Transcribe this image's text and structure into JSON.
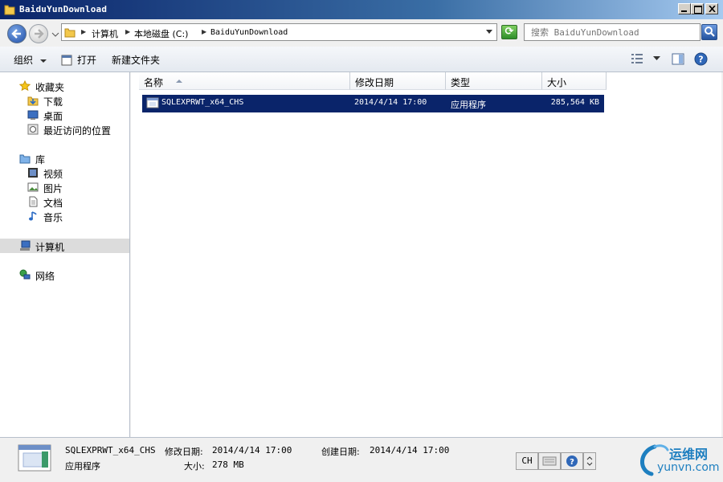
{
  "window": {
    "title": "BaiduYunDownload"
  },
  "address": {
    "crumbs": [
      "计算机",
      "本地磁盘 (C:)",
      "BaiduYunDownload"
    ]
  },
  "search": {
    "placeholder": "搜索 BaiduYunDownload"
  },
  "toolbar": {
    "organize": "组织",
    "open": "打开",
    "new_folder": "新建文件夹"
  },
  "sidebar": {
    "favorites": "收藏夹",
    "favorites_items": [
      "下载",
      "桌面",
      "最近访问的位置"
    ],
    "libraries": "库",
    "library_items": [
      "视频",
      "图片",
      "文档",
      "音乐"
    ],
    "computer": "计算机",
    "network": "网络"
  },
  "columns": [
    "名称",
    "修改日期",
    "类型",
    "大小"
  ],
  "files": [
    {
      "name": "SQLEXPRWT_x64_CHS",
      "modified": "2014/4/14 17:00",
      "type": "应用程序",
      "size": "285,564 KB"
    }
  ],
  "details": {
    "name": "SQLEXPRWT_x64_CHS",
    "modified_label": "修改日期:",
    "modified": "2014/4/14 17:00",
    "created_label": "创建日期:",
    "created": "2014/4/14 17:00",
    "type": "应用程序",
    "size_label": "大小:",
    "size": "278 MB"
  },
  "tray": {
    "lang": "CH"
  },
  "watermark": {
    "brand": "运维网",
    "domain": "yunvn.com"
  },
  "colors": {
    "title_start": "#0a246a",
    "title_end": "#a6caf0",
    "selection": "#0a246a",
    "refresh": "#2f8e2a",
    "logo": "#1e7fc0"
  }
}
